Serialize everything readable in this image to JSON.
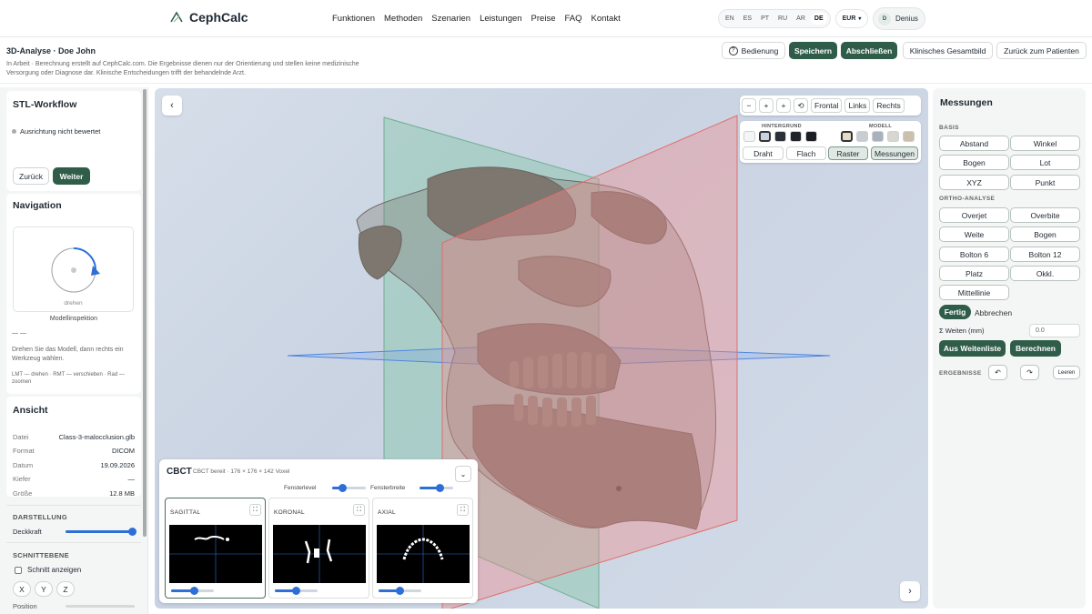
{
  "brand": {
    "name": "CephCalc"
  },
  "nav": {
    "links": [
      "Funktionen",
      "Methoden",
      "Szenarien",
      "Leistungen",
      "Preise",
      "FAQ",
      "Kontakt"
    ]
  },
  "languages": {
    "items": [
      "EN",
      "ES",
      "PT",
      "RU",
      "AR",
      "DE"
    ],
    "active": "DE"
  },
  "currency": {
    "label": "EUR"
  },
  "user": {
    "initial": "D",
    "name": "Denius"
  },
  "header": {
    "title": "3D-Analyse · Doe John",
    "desc": "In Arbeit · Berechnung erstellt auf CephCalc.com. Die Ergebnisse dienen nur der Orientierung und stellen keine medizinische Versorgung oder Diagnose dar. Klinische Entscheidungen trifft der behandelnde Arzt.",
    "btn_help": "Bedienung",
    "btn_save": "Speichern",
    "btn_finish": "Abschließen",
    "btn_overview": "Klinisches Gesamtbild",
    "btn_back": "Zurück zum Patienten"
  },
  "sidebar": {
    "workflow_title": "STL-Workflow",
    "workflow_status": "Ausrichtung nicht bewertet",
    "btn_back": "Zurück",
    "btn_next": "Weiter",
    "nav_title": "Navigation",
    "nav_mode": "drehen",
    "nav_caption": "Modellinspektion",
    "nav_dash": "— —",
    "nav_hint": "Drehen Sie das Modell, dann rechts ein Werkzeug wählen.",
    "nav_keys": "LMT — drehen · RMT — verschieben · Rad — zoomen",
    "view_title": "Ansicht",
    "info": [
      {
        "k": "Datei",
        "v": "Class-3-malocclusion.glb"
      },
      {
        "k": "Format",
        "v": "DICOM"
      },
      {
        "k": "Datum",
        "v": "19.09.2026"
      },
      {
        "k": "Kiefer",
        "v": "—"
      },
      {
        "k": "Größe",
        "v": "12.8 MB"
      }
    ],
    "display_title": "DARSTELLUNG",
    "opacity_label": "Deckkraft",
    "opacity": 0.97,
    "section_title": "SCHNITTEBENE",
    "section_show": "Schnitt anzeigen",
    "axes": [
      "X",
      "Y",
      "Z"
    ],
    "position_label": "Position"
  },
  "viewport": {
    "toolbar": [
      "−",
      "+",
      "+",
      "⟲",
      "Frontal",
      "Links",
      "Rechts"
    ],
    "bg_label": "HINTERGRUND",
    "model_label": "MODELL",
    "bg_colors": [
      "#f4f5f7",
      "#c8d2e0",
      "#2b3038",
      "#20242a",
      "#1b1e23"
    ],
    "model_colors": [
      "#e5dcc8",
      "#c9cdd3",
      "#a9b1bc",
      "#d8d6d0",
      "#cbbfae"
    ],
    "modes": [
      "Draht",
      "Flach",
      "Raster",
      "Messungen"
    ],
    "active_modes": [
      "Raster",
      "Messungen"
    ]
  },
  "cbct": {
    "title": "CBCT",
    "status": "CBCT bereit · 176 × 176 × 142 Voxel",
    "level_label": "Fensterlevel",
    "width_label": "Fensterbreite",
    "level": 0.3,
    "width": 0.6,
    "slices": [
      {
        "label": "SAGITTAL",
        "pos": 0.55
      },
      {
        "label": "KORONAL",
        "pos": 0.5
      },
      {
        "label": "AXIAL",
        "pos": 0.5
      }
    ]
  },
  "measure": {
    "title": "Messungen",
    "basis_label": "BASIS",
    "basis": [
      "Abstand",
      "Winkel",
      "Bogen",
      "Lot",
      "XYZ",
      "Punkt"
    ],
    "ortho_label": "ORTHO-ANALYSE",
    "ortho": [
      "Overjet",
      "Overbite",
      "Weite",
      "Bogen",
      "Bolton 6",
      "Bolton 12",
      "Platz",
      "Okkl.",
      "Mittellinie"
    ],
    "btn_done": "Fertig",
    "btn_cancel": "Abbrechen",
    "sum_label": "Σ Weiten (mm)",
    "sum_value": "0.0",
    "btn_from_list": "Aus Weitenliste",
    "btn_calc": "Berechnen",
    "results_label": "ERGEBNISSE",
    "btn_clear": "Leeren",
    "undo_icon": "↶",
    "redo_icon": "↷"
  }
}
